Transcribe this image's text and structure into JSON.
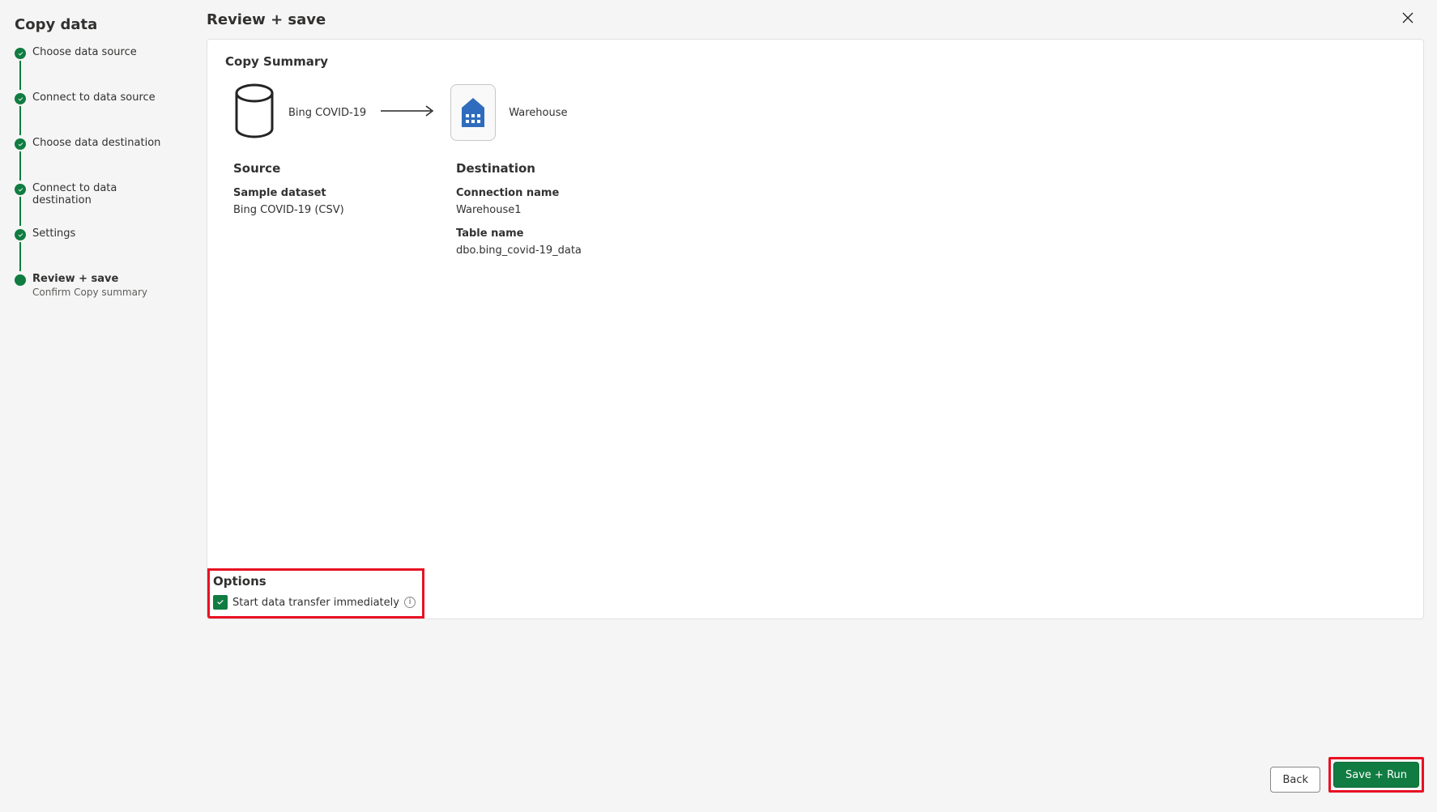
{
  "sidebar": {
    "title": "Copy data",
    "steps": [
      {
        "label": "Choose data source"
      },
      {
        "label": "Connect to data source"
      },
      {
        "label": "Choose data destination"
      },
      {
        "label": "Connect to data destination"
      },
      {
        "label": "Settings"
      },
      {
        "label": "Review + save",
        "subtext": "Confirm Copy summary"
      }
    ]
  },
  "header": {
    "title": "Review + save"
  },
  "summary": {
    "section_title": "Copy Summary",
    "source_name": "Bing COVID-19",
    "dest_name": "Warehouse",
    "source": {
      "heading": "Source",
      "fields": [
        {
          "label": "Sample dataset",
          "value": "Bing COVID-19 (CSV)"
        }
      ]
    },
    "destination": {
      "heading": "Destination",
      "fields": [
        {
          "label": "Connection name",
          "value": "Warehouse1"
        },
        {
          "label": "Table name",
          "value": "dbo.bing_covid-19_data"
        }
      ]
    }
  },
  "options": {
    "heading": "Options",
    "checkbox_label": "Start data transfer immediately",
    "checked": true
  },
  "footer": {
    "back_label": "Back",
    "primary_label": "Save + Run"
  }
}
